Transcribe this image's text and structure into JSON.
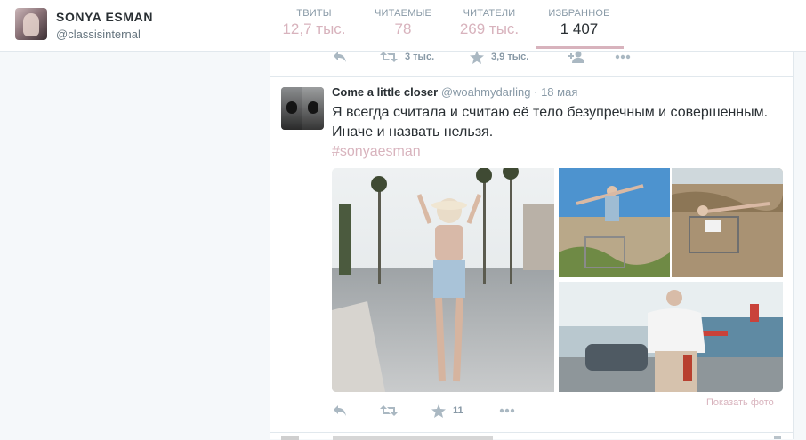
{
  "profile": {
    "name": "SONYA ESMAN",
    "handle": "@classisinternal"
  },
  "stats": [
    {
      "label": "ТВИТЫ",
      "value": "12,7 тыс."
    },
    {
      "label": "ЧИТАЕМЫЕ",
      "value": "78"
    },
    {
      "label": "ЧИТАТЕЛИ",
      "value": "269 тыс."
    },
    {
      "label": "ИЗБРАННОЕ",
      "value": "1 407",
      "active": true
    }
  ],
  "prev_tweet_actions": {
    "retweets": "3 тыс.",
    "favorites": "3,9 тыс."
  },
  "tweet": {
    "name": "Come a little closer",
    "handle": "@woahmydarling",
    "dot": "·",
    "date": "18 мая",
    "text": "Я всегда считала и считаю её тело безупречным и совершенным. Иначе и назвать нельзя.",
    "hashtag": "#sonyaesman",
    "favorites": "11",
    "show_photo": "Показать фото"
  },
  "colors": {
    "accent": "#d8b3bd",
    "muted": "#8899a6",
    "border": "#e1e8ed",
    "background": "#f5f8fa"
  },
  "icons": [
    "reply-icon",
    "retweet-icon",
    "star-icon",
    "follow-icon",
    "more-icon"
  ]
}
